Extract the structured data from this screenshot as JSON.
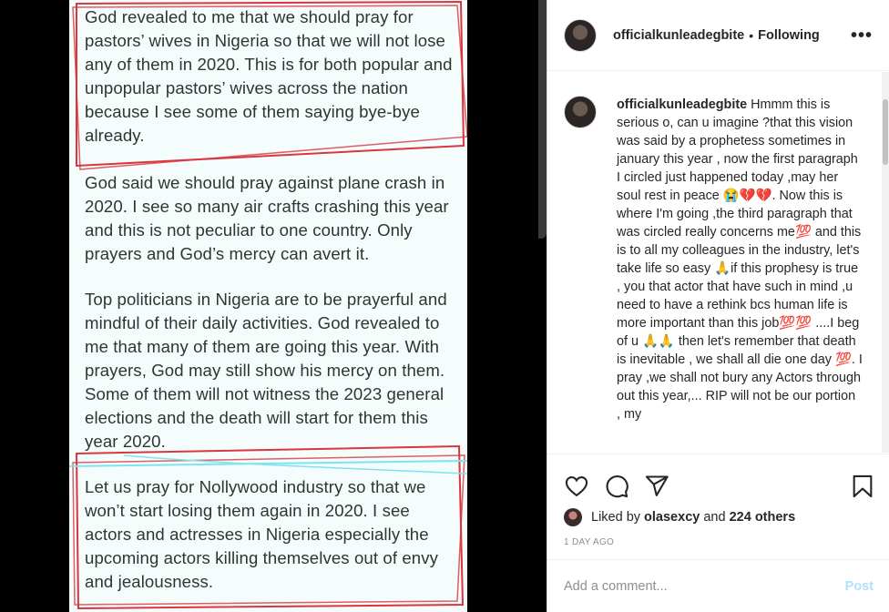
{
  "photo": {
    "paragraphs": [
      "God revealed to me that we should pray for pastors’ wives in Nigeria so that we will not lose any of them in 2020. This is for both popular and unpopular pastors’ wives across the nation because I see some of them saying bye-bye already.",
      "God said we should pray against plane crash in 2020. I see so many air crafts crashing this year and this is not peculiar to one country. Only prayers and God’s mercy can avert it.",
      " Top politicians in Nigeria are to be prayerful and mindful of their daily activities. God revealed to me that many of them are going this year. With prayers, God may still show his mercy on them. Some of them will not witness the 2023 general elections and the death will start for them this year 2020.",
      "Let us pray for Nollywood industry so that we won’t start losing them again in 2020. I see actors and actresses in Nigeria especially the upcoming actors killing themselves out of envy and jealousness."
    ]
  },
  "header": {
    "username": "officialkunleadegbite",
    "separator": "•",
    "follow_status": "Following",
    "more_icon": "more-horizontal-icon"
  },
  "caption": {
    "username": "officialkunleadegbite",
    "text": "Hmmm this is serious o, can u imagine ?that this vision was said by a prophetess sometimes in january this year , now the first paragraph I circled just happened today ,may her soul rest in peace 😭💔💔. Now this is where I'm going ,the third paragraph that was circled really concerns me💯 and this is to all my colleagues in the industry, let's take life so easy 🙏if this prophesy is true , you that actor that have such in mind ,u need to have a rethink bcs human life is more important than this job💯💯 ....I beg of u 🙏🙏 then let's remember that death is inevitable , we shall all die one day 💯. I pray ,we shall not bury any Actors through out this year,... RIP will not be our portion , my"
  },
  "actions": {
    "icons": [
      "heart-icon",
      "comment-icon",
      "share-icon",
      "bookmark-icon"
    ],
    "liked_by_prefix": "Liked by",
    "liked_by_user": "olasexcy",
    "liked_by_and": "and",
    "liked_by_others": "224 others",
    "timestamp": "1 DAY AGO"
  },
  "comment_box": {
    "placeholder": "Add a comment...",
    "post_label": "Post"
  },
  "colors": {
    "ink_red": "#d9363e",
    "ink_cyan": "#7fe3f0",
    "post_disabled": "#b2dffc"
  }
}
